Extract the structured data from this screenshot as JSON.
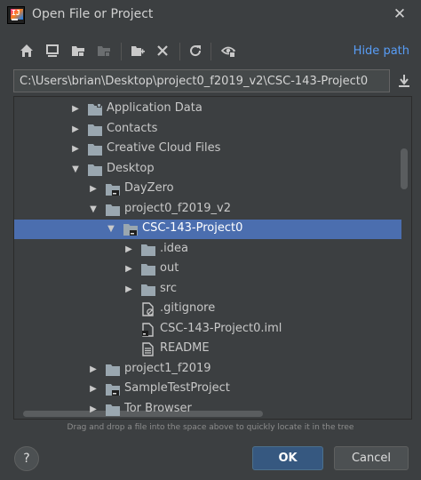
{
  "window": {
    "title": "Open File or Project"
  },
  "app_icon": {
    "text": "IJ"
  },
  "toolbar": {
    "icons": [
      "home-icon",
      "desktop-icon",
      "project-folder-icon",
      "module-folder-icon",
      "new-folder-icon",
      "delete-icon",
      "refresh-icon",
      "show-hidden-icon"
    ],
    "hide_path_label": "Hide path"
  },
  "path": {
    "value": "C:\\Users\\brian\\Desktop\\project0_f2019_v2\\CSC-143-Project0"
  },
  "tree": {
    "rows": [
      {
        "label": "Application Data",
        "depth": 0,
        "arrow": "right",
        "icon": "folder-special"
      },
      {
        "label": "Contacts",
        "depth": 0,
        "arrow": "right",
        "icon": "folder"
      },
      {
        "label": "Creative Cloud Files",
        "depth": 0,
        "arrow": "right",
        "icon": "folder"
      },
      {
        "label": "Desktop",
        "depth": 0,
        "arrow": "down",
        "icon": "folder"
      },
      {
        "label": "DayZero",
        "depth": 1,
        "arrow": "right",
        "icon": "project-folder"
      },
      {
        "label": "project0_f2019_v2",
        "depth": 1,
        "arrow": "down",
        "icon": "folder"
      },
      {
        "label": "CSC-143-Project0",
        "depth": 2,
        "arrow": "down",
        "icon": "project-folder",
        "selected": true
      },
      {
        "label": ".idea",
        "depth": 3,
        "arrow": "right",
        "icon": "folder"
      },
      {
        "label": "out",
        "depth": 3,
        "arrow": "right",
        "icon": "folder"
      },
      {
        "label": "src",
        "depth": 3,
        "arrow": "right",
        "icon": "folder"
      },
      {
        "label": ".gitignore",
        "depth": 3,
        "arrow": "",
        "icon": "ignore-file"
      },
      {
        "label": "CSC-143-Project0.iml",
        "depth": 3,
        "arrow": "",
        "icon": "iml-file"
      },
      {
        "label": "README",
        "depth": 3,
        "arrow": "",
        "icon": "text-file"
      },
      {
        "label": "project1_f2019",
        "depth": 1,
        "arrow": "right",
        "icon": "folder"
      },
      {
        "label": "SampleTestProject",
        "depth": 1,
        "arrow": "right",
        "icon": "project-folder"
      },
      {
        "label": "Tor Browser",
        "depth": 1,
        "arrow": "right",
        "icon": "folder"
      }
    ]
  },
  "hint": "Drag and drop a file into the space above to quickly locate it in the tree",
  "buttons": {
    "help": "?",
    "ok": "OK",
    "cancel": "Cancel"
  },
  "colors": {
    "background": "#3c3f41",
    "selection": "#4b6eaf",
    "link": "#589df6",
    "ok_button": "#365880",
    "folder": "#9aa7b0"
  }
}
